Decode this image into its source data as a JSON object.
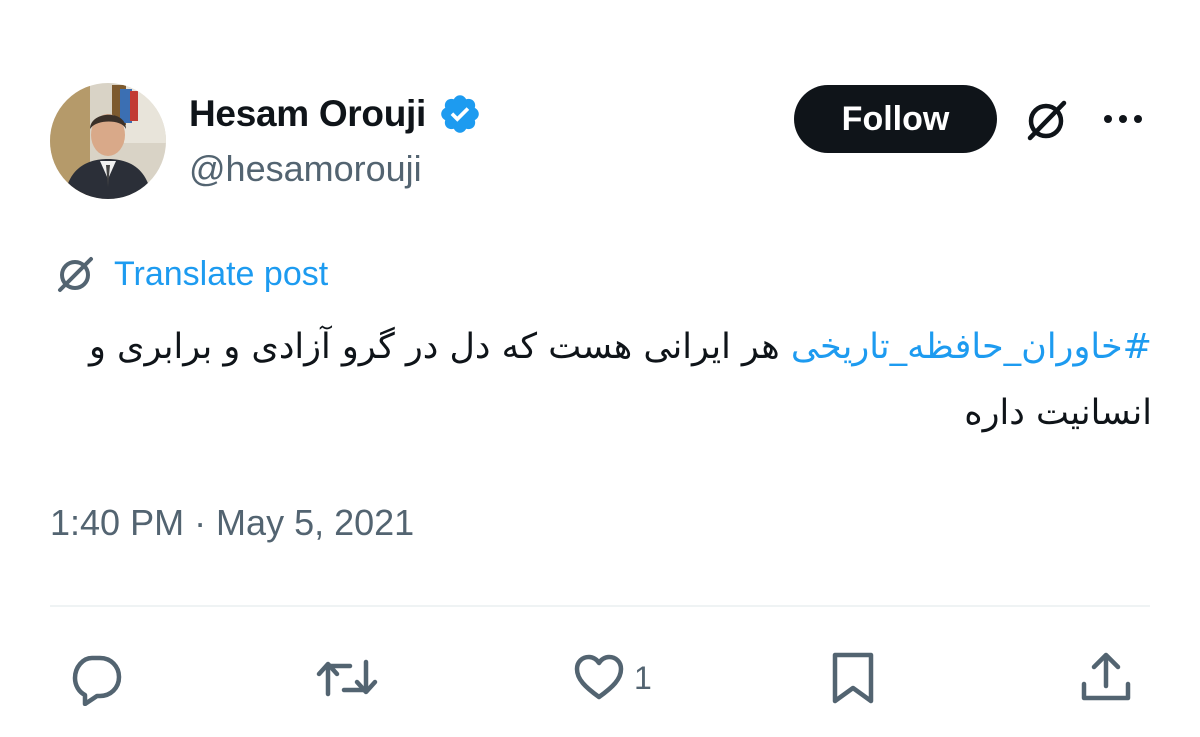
{
  "author": {
    "display_name": "Hesam Orouji",
    "handle": "@hesamorouji",
    "verified": true,
    "verified_color": "#1d9bf0"
  },
  "header": {
    "follow_label": "Follow",
    "grok_icon": "grok-icon",
    "more_icon": "more-icon"
  },
  "translate": {
    "label": "Translate post",
    "icon": "grok-icon"
  },
  "tweet": {
    "hashtag": "#خاوران_حافظه_تاریخی",
    "text": " هر ایرانی هست که دل در گرو آزادی و برابری و انسانیت داره",
    "timestamp": "1:40 PM · May 5, 2021"
  },
  "actions": {
    "reply_icon": "reply-icon",
    "retweet_icon": "retweet-icon",
    "like_icon": "like-icon",
    "like_count": "1",
    "bookmark_icon": "bookmark-icon",
    "share_icon": "share-icon"
  },
  "colors": {
    "text": "#0f1419",
    "secondary": "#536471",
    "accent": "#1d9bf0",
    "divider": "#eff3f4"
  }
}
